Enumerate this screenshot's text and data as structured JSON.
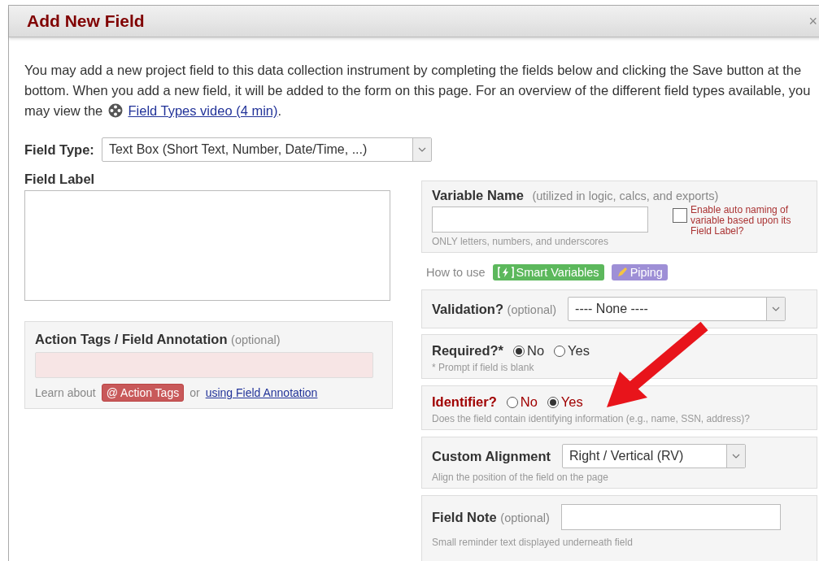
{
  "dialog": {
    "title": "Add New Field",
    "close": "×"
  },
  "intro": {
    "text": "You may add a new project field to this data collection instrument by completing the fields below and clicking the Save button at the bottom. When you add a new field, it will be added to the form on this page. For an overview of the different field types available, you may view the",
    "link": "Field Types video (4 min)",
    "end": "."
  },
  "field_type": {
    "label": "Field Type:",
    "value": "Text Box (Short Text, Number, Date/Time, ...)"
  },
  "field_label": {
    "label": "Field Label"
  },
  "action_tags": {
    "label": "Action Tags / Field Annotation",
    "optional": "(optional)",
    "learn": "Learn about",
    "tag_button": "@ Action Tags",
    "or": "or",
    "link": "using Field Annotation"
  },
  "variable_name": {
    "label": "Variable Name",
    "hint": "(utilized in logic, calcs, and exports)",
    "help": "ONLY letters, numbers, and underscores",
    "auto_naming": {
      "label": "Enable auto naming of variable based upon its Field Label?",
      "checked": false
    }
  },
  "how_to_use": {
    "label": "How to use",
    "buttons": [
      {
        "kind": "smart",
        "label": "Smart Variables",
        "color": "#5cb85c"
      },
      {
        "kind": "piping",
        "label": "Piping",
        "color": "#9e8fd6"
      }
    ]
  },
  "validation": {
    "label": "Validation?",
    "optional": "(optional)",
    "value": "---- None ----"
  },
  "required": {
    "label": "Required?*",
    "options": [
      {
        "label": "No",
        "selected": true
      },
      {
        "label": "Yes",
        "selected": false
      }
    ],
    "note": "* Prompt if field is blank"
  },
  "identifier": {
    "label": "Identifier?",
    "options": [
      {
        "label": "No",
        "selected": false
      },
      {
        "label": "Yes",
        "selected": true
      }
    ],
    "note": "Does the field contain identifying information (e.g., name, SSN, address)?"
  },
  "alignment": {
    "label": "Custom Alignment",
    "value": "Right / Vertical (RV)",
    "note": "Align the position of the field on the page"
  },
  "field_note": {
    "label": "Field Note",
    "optional": "(optional)",
    "note": "Small reminder text displayed underneath field"
  }
}
